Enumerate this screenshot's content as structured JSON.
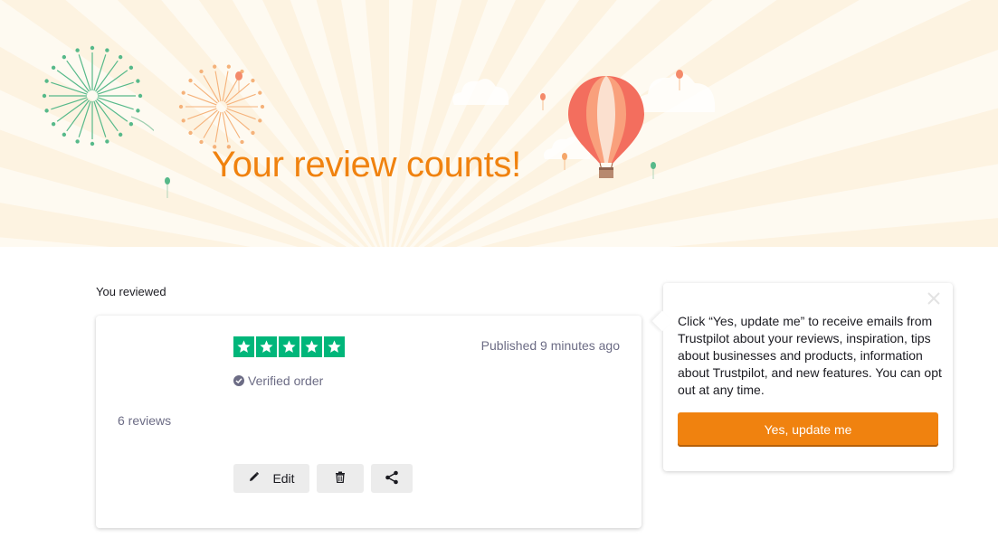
{
  "hero": {
    "title": "Your review counts!"
  },
  "review": {
    "section_label": "You reviewed",
    "business_reviews_count": "6 reviews",
    "rating": 5,
    "published": "Published 9 minutes ago",
    "verified_label": "Verified order",
    "actions": {
      "edit_label": "Edit"
    }
  },
  "popover": {
    "message": "Click “Yes, update me” to receive emails from Trustpilot about your reviews, inspiration, tips about businesses and products, information about Trustpilot, and new features. You can opt out at any time.",
    "cta_label": "Yes, update me"
  },
  "colors": {
    "brand_orange": "#f0820f",
    "star_green": "#00b67a",
    "muted_text": "#6c6c85",
    "hero_bg": "#fdf3e1"
  },
  "icons": [
    "star-icon",
    "check-circle-icon",
    "pencil-icon",
    "trash-icon",
    "share-icon",
    "close-icon",
    "hot-air-balloon-icon",
    "firework-icon",
    "cloud-icon",
    "balloon-icon"
  ]
}
